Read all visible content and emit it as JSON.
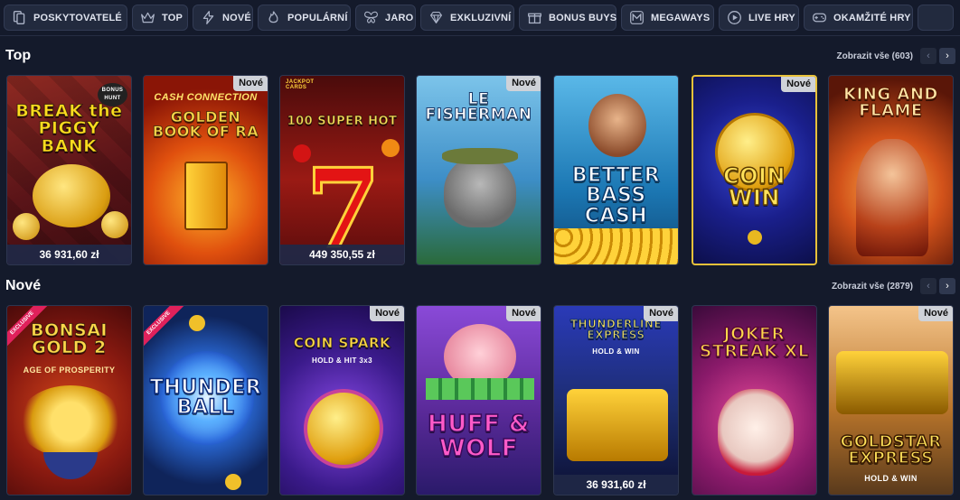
{
  "categories": [
    {
      "label": "POSKYTOVATELÉ",
      "icon": "providers-icon"
    },
    {
      "label": "TOP",
      "icon": "crown-icon"
    },
    {
      "label": "NOVÉ",
      "icon": "lightning-icon"
    },
    {
      "label": "POPULÁRNÍ",
      "icon": "flame-icon"
    },
    {
      "label": "JARO",
      "icon": "butterfly-icon"
    },
    {
      "label": "EXKLUZIVNÍ",
      "icon": "diamond-icon"
    },
    {
      "label": "BONUS BUYS",
      "icon": "gift-icon"
    },
    {
      "label": "MEGAWAYS",
      "icon": "megaways-icon"
    },
    {
      "label": "LIVE HRY",
      "icon": "play-icon"
    },
    {
      "label": "OKAMŽITÉ HRY",
      "icon": "gamepad-icon"
    }
  ],
  "sections": [
    {
      "title": "Top",
      "see_all": "Zobrazit vše (603)",
      "games": [
        {
          "title": "BREAK the PIGGY BANK",
          "subtitle": "BONUS HUNT",
          "new_badge": "",
          "jackpot": "36 931,60 zł",
          "ribbon": "",
          "bg": "#6b1a1f"
        },
        {
          "title": "GOLDEN BOOK OF RA",
          "subtitle": "CASH CONNECTION",
          "new_badge": "Nové",
          "jackpot": "",
          "ribbon": "",
          "bg": "#a32410"
        },
        {
          "title": "100 SUPER HOT",
          "subtitle": "JACKPOT CARDS",
          "new_badge": "",
          "jackpot": "449 350,55 zł",
          "ribbon": "",
          "bg": "#7a1313"
        },
        {
          "title": "LE FISHERMAN",
          "subtitle": "",
          "new_badge": "Nové",
          "jackpot": "",
          "ribbon": "",
          "bg": "#3f8ac2"
        },
        {
          "title": "BETTER BASS CASH",
          "subtitle": "",
          "new_badge": "",
          "jackpot": "",
          "ribbon": "",
          "bg": "#1c78b4"
        },
        {
          "title": "COIN WIN",
          "subtitle": "",
          "new_badge": "Nové",
          "jackpot": "",
          "ribbon": "",
          "bg": "#1a1f8c"
        },
        {
          "title": "KING AND FLAME",
          "subtitle": "",
          "new_badge": "",
          "jackpot": "",
          "ribbon": "",
          "bg": "#8a2c10"
        }
      ]
    },
    {
      "title": "Nové",
      "see_all": "Zobrazit vše (2879)",
      "games": [
        {
          "title": "BONSAI GOLD 2",
          "subtitle": "AGE OF PROSPERITY",
          "new_badge": "",
          "jackpot": "",
          "ribbon": "EXCLUSIVE",
          "bg": "#7a1414"
        },
        {
          "title": "THUNDER BALL",
          "subtitle": "",
          "new_badge": "",
          "jackpot": "",
          "ribbon": "EXCLUSIVE",
          "bg": "#12307a"
        },
        {
          "title": "COIN SPARK",
          "subtitle": "HOLD & HIT 3x3",
          "new_badge": "Nové",
          "jackpot": "",
          "ribbon": "",
          "bg": "#3a1a8a"
        },
        {
          "title": "HUFF & WOLF",
          "subtitle": "",
          "new_badge": "Nové",
          "jackpot": "",
          "ribbon": "",
          "bg": "#5b2a9a"
        },
        {
          "title": "THUNDERLINE EXPRESS",
          "subtitle": "HOLD & WIN",
          "new_badge": "Nové",
          "jackpot": "36 931,60 zł",
          "ribbon": "",
          "bg": "#1c2c6e"
        },
        {
          "title": "JOKER STREAK XL",
          "subtitle": "",
          "new_badge": "",
          "jackpot": "",
          "ribbon": "",
          "bg": "#6a1a55"
        },
        {
          "title": "GOLDSTAR EXPRESS",
          "subtitle": "HOLD & WIN",
          "new_badge": "Nové",
          "jackpot": "",
          "ribbon": "",
          "bg": "#5a3a1c"
        }
      ]
    }
  ],
  "nav": {
    "prev": "‹",
    "next": "›"
  }
}
